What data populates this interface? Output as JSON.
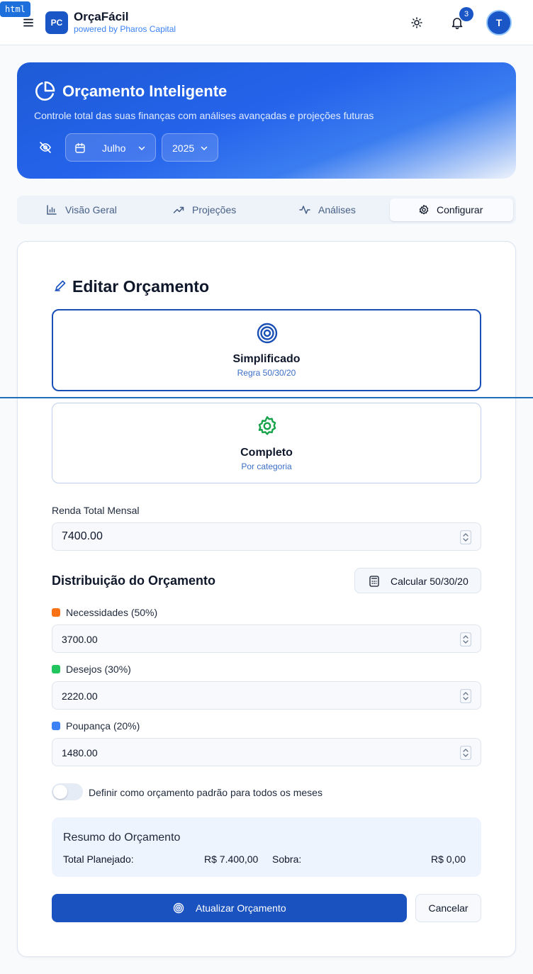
{
  "debug_tag": "html",
  "header": {
    "logo_text": "PC",
    "app_name": "OrçaFácil",
    "app_sub": "powered by Pharos Capital",
    "notification_count": "3",
    "avatar_initial": "T"
  },
  "hero": {
    "title": "Orçamento Inteligente",
    "subtitle": "Controle total das suas finanças com análises avançadas e projeções futuras",
    "month": "Julho",
    "year": "2025"
  },
  "tabs": [
    {
      "label": "Visão Geral",
      "icon": "bar-chart-icon",
      "active": false
    },
    {
      "label": "Projeções",
      "icon": "trending-up-icon",
      "active": false
    },
    {
      "label": "Análises",
      "icon": "activity-icon",
      "active": false
    },
    {
      "label": "Configurar",
      "icon": "gear-icon",
      "active": true
    }
  ],
  "editor": {
    "title": "Editar Orçamento",
    "modes": [
      {
        "title": "Simplificado",
        "subtitle": "Regra 50/30/20",
        "icon": "target-icon",
        "selected": true
      },
      {
        "title": "Completo",
        "subtitle": "Por categoria",
        "icon": "gear-icon",
        "selected": false
      }
    ],
    "income_label": "Renda Total Mensal",
    "income_value": "7400.00",
    "distribution_title": "Distribuição do Orçamento",
    "calc_button": "Calcular 50/30/20",
    "categories": [
      {
        "label": "Necessidades (50%)",
        "value": "3700.00",
        "color": "#f97316"
      },
      {
        "label": "Desejos (30%)",
        "value": "2220.00",
        "color": "#22c55e"
      },
      {
        "label": "Poupança (20%)",
        "value": "1480.00",
        "color": "#3b82f6"
      }
    ],
    "default_toggle_label": "Definir como orçamento padrão para todos os meses",
    "default_toggle_on": false,
    "summary": {
      "title": "Resumo do Orçamento",
      "planned_label": "Total Planejado:",
      "planned_value": "R$ 7.400,00",
      "leftover_label": "Sobra:",
      "leftover_value": "R$ 0,00"
    },
    "submit_button": "Atualizar Orçamento",
    "cancel_button": "Cancelar"
  },
  "colors": {
    "primary": "#1a52bf",
    "hero_gradient_start": "#1d5bd6"
  }
}
